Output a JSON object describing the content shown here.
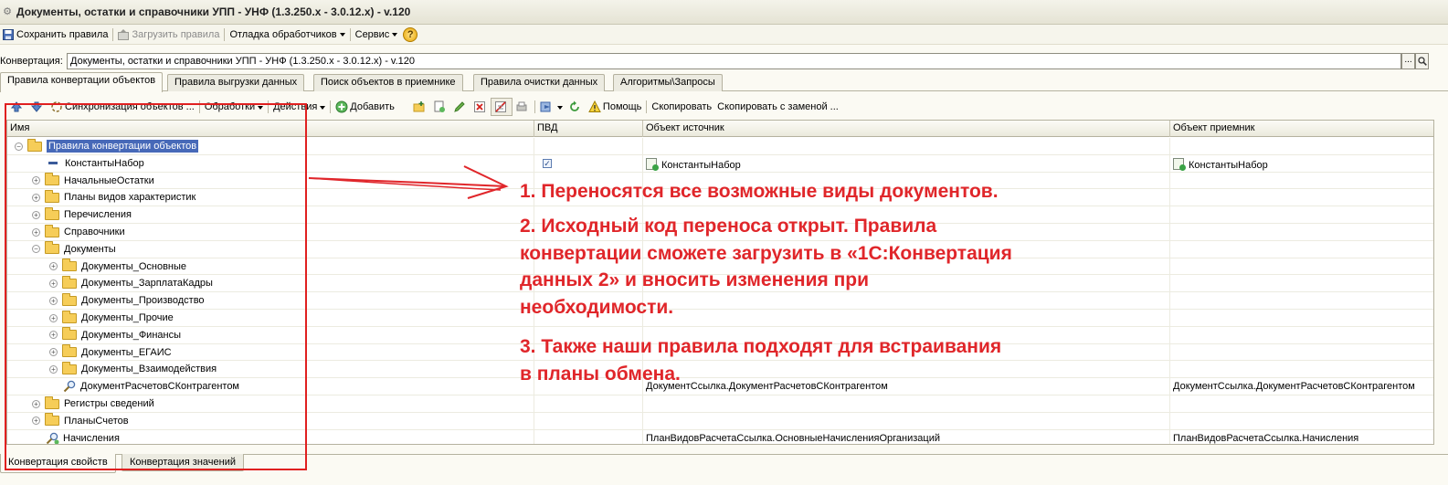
{
  "window": {
    "title": "Документы, остатки и справочники УПП - УНФ (1.3.250.x - 3.0.12.x) - v.120"
  },
  "menubar": {
    "save_rules": "Сохранить правила",
    "load_rules": "Загрузить правила",
    "debug_handlers": "Отладка обработчиков",
    "service": "Сервис"
  },
  "conversion": {
    "label": "Конвертация:",
    "value": "Документы, остатки и справочники УПП - УНФ (1.3.250.x - 3.0.12.x) - v.120",
    "select_button": "...",
    "open_button": "Q"
  },
  "tabs": [
    {
      "label": "Правила конвертации объектов",
      "active": true
    },
    {
      "label": "Правила выгрузки данных"
    },
    {
      "label": "Поиск объектов в приемнике"
    },
    {
      "label": "Правила очистки данных"
    },
    {
      "label": "Алгоритмы\\Запросы"
    }
  ],
  "toolbar": {
    "sync_objects": "Синхронизация объектов ...",
    "handlers": "Обработки",
    "actions": "Действия",
    "add": "Добавить",
    "help": "Помощь",
    "copy": "Скопировать",
    "copy_replace": "Скопировать с заменой ..."
  },
  "grid": {
    "columns": {
      "name": "Имя",
      "pvd": "ПВД",
      "source": "Объект источник",
      "target": "Объект приемник"
    },
    "rows": [
      {
        "name": "Правила конвертации объектов",
        "pvd": "",
        "source": "",
        "target": ""
      },
      {
        "name": "КонстантыНабор",
        "pvd": "",
        "source": "КонстантыНабор",
        "target": "КонстантыНабор"
      },
      {
        "name": "НачальныеОстатки",
        "pvd": "",
        "source": "",
        "target": ""
      },
      {
        "name": "Планы видов характеристик",
        "pvd": "",
        "source": "",
        "target": ""
      },
      {
        "name": "Перечисления",
        "pvd": "",
        "source": "",
        "target": ""
      },
      {
        "name": "Справочники",
        "pvd": "",
        "source": "",
        "target": ""
      },
      {
        "name": "Документы",
        "pvd": "",
        "source": "",
        "target": ""
      },
      {
        "name": "Документы_Основные",
        "pvd": "",
        "source": "",
        "target": ""
      },
      {
        "name": "Документы_ЗарплатаКадры",
        "pvd": "",
        "source": "",
        "target": ""
      },
      {
        "name": "Документы_Производство",
        "pvd": "",
        "source": "",
        "target": ""
      },
      {
        "name": "Документы_Прочие",
        "pvd": "",
        "source": "",
        "target": ""
      },
      {
        "name": "Документы_Финансы",
        "pvd": "",
        "source": "",
        "target": ""
      },
      {
        "name": "Документы_ЕГАИС",
        "pvd": "",
        "source": "",
        "target": ""
      },
      {
        "name": "Документы_Взаимодействия",
        "pvd": "",
        "source": "",
        "target": ""
      },
      {
        "name": "ДокументРасчетовСКонтрагентом",
        "pvd": "",
        "source": "ДокументСсылка.ДокументРасчетовСКонтрагентом",
        "target": "ДокументСсылка.ДокументРасчетовСКонтрагентом"
      },
      {
        "name": "Регистры сведений",
        "pvd": "",
        "source": "",
        "target": ""
      },
      {
        "name": "ПланыСчетов",
        "pvd": "",
        "source": "",
        "target": ""
      },
      {
        "name": "Начисления",
        "pvd": "",
        "source": "ПланВидовРасчетаСсылка.ОсновныеНачисленияОрганизаций",
        "target": "ПланВидовРасчетаСсылка.Начисления"
      }
    ]
  },
  "bottom_tabs": [
    {
      "label": "Конвертация свойств",
      "active": true
    },
    {
      "label": "Конвертация значений"
    }
  ],
  "annotations": [
    {
      "lines": [
        "1. Переносятся все возможные виды документов."
      ]
    },
    {
      "lines": [
        "2. Исходный код переноса открыт. Правила",
        "конвертации сможете загрузить в «1С:Конвертация",
        "данных 2» и вносить изменения при",
        "необходимости."
      ]
    },
    {
      "lines": [
        "3. Также наши правила подходят для встраивания",
        "в планы обмена."
      ]
    }
  ],
  "colors": {
    "annotation": "#e0262a",
    "selection": "#4769b8"
  }
}
